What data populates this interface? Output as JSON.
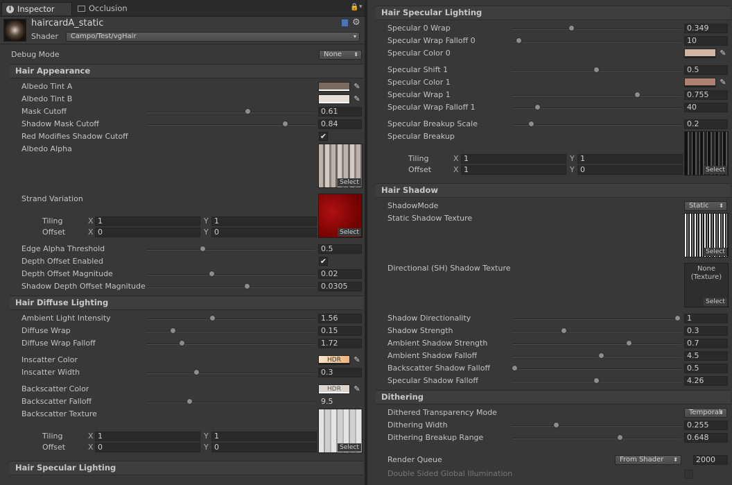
{
  "tabs": {
    "inspector": "Inspector",
    "occlusion": "Occlusion"
  },
  "material": {
    "name": "haircardA_static",
    "shader_label": "Shader",
    "shader_value": "Campo/Test/vgHair"
  },
  "debug": {
    "label": "Debug Mode",
    "value": "None"
  },
  "texture_select_label": "Select",
  "tiling_label": "Tiling",
  "offset_label": "Offset",
  "x_label": "X",
  "y_label": "Y",
  "hdr_label": "HDR",
  "hair_appearance": {
    "title": "Hair Appearance",
    "albedo_tint_a": {
      "label": "Albedo Tint A",
      "color": "#7b6a5e"
    },
    "albedo_tint_b": {
      "label": "Albedo Tint B",
      "color": "#e7dfd6"
    },
    "mask_cutoff": {
      "label": "Mask Cutoff",
      "value": "0.61",
      "fraction": 0.61
    },
    "shadow_mask_cutoff": {
      "label": "Shadow Mask Cutoff",
      "value": "0.84",
      "fraction": 0.84
    },
    "red_modifies": {
      "label": "Red Modifies Shadow Cutoff",
      "checked": true
    },
    "albedo_alpha": {
      "label": "Albedo Alpha"
    },
    "strand_variation": {
      "label": "Strand Variation",
      "tiling_x": "1",
      "tiling_y": "1",
      "offset_x": "0",
      "offset_y": "0"
    },
    "edge_alpha": {
      "label": "Edge Alpha Threshold",
      "value": "0.5",
      "fraction": 0.33
    },
    "depth_offset_enabled": {
      "label": "Depth Offset Enabled",
      "checked": true
    },
    "depth_offset_mag": {
      "label": "Depth Offset Magnitude",
      "value": "0.02",
      "fraction": 0.39
    },
    "shadow_depth_offset": {
      "label": "Shadow Depth Offset Magnitude",
      "value": "0.0305",
      "fraction": 0.59
    }
  },
  "hair_diffuse": {
    "title": "Hair Diffuse Lighting",
    "ambient": {
      "label": "Ambient Light Intensity",
      "value": "1.56",
      "fraction": 0.39
    },
    "diffuse_wrap": {
      "label": "Diffuse Wrap",
      "value": "0.15",
      "fraction": 0.16
    },
    "diffuse_wrap_falloff": {
      "label": "Diffuse Wrap Falloff",
      "value": "1.72",
      "fraction": 0.21
    },
    "inscatter_color": {
      "label": "Inscatter Color",
      "color": "#f4c99a"
    },
    "inscatter_width": {
      "label": "Inscatter Width",
      "value": "0.3",
      "fraction": 0.3
    },
    "backscatter_color": {
      "label": "Backscatter Color",
      "color": "#d8cfc8"
    },
    "backscatter_falloff": {
      "label": "Backscatter Falloff",
      "value": "9.5",
      "fraction": 0.26
    },
    "backscatter_texture": {
      "label": "Backscatter Texture",
      "tiling_x": "1",
      "tiling_y": "1",
      "offset_x": "0",
      "offset_y": "0"
    }
  },
  "hair_specular_left": {
    "title": "Hair Specular Lighting"
  },
  "hair_specular": {
    "title": "Hair Specular Lighting",
    "spec0_wrap": {
      "label": "Specular 0 Wrap",
      "value": "0.349",
      "fraction": 0.35
    },
    "spec_wrap_falloff0": {
      "label": "Specular Wrap Falloff 0",
      "value": "10",
      "fraction": 0.04
    },
    "spec_color0": {
      "label": "Specular Color 0",
      "color": "#d0b4a4"
    },
    "spec_shift1": {
      "label": "Specular Shift 1",
      "value": "0.5",
      "fraction": 0.5
    },
    "spec_color1": {
      "label": "Specular Color 1",
      "color": "#b08070"
    },
    "spec_wrap1": {
      "label": "Specular Wrap 1",
      "value": "0.755",
      "fraction": 0.755
    },
    "spec_wrap_falloff1": {
      "label": "Specular Wrap Falloff 1",
      "value": "40",
      "fraction": 0.15
    },
    "breakup_scale": {
      "label": "Specular Breakup Scale",
      "value": "0.2",
      "fraction": 0.12
    },
    "breakup": {
      "label": "Specular Breakup",
      "tiling_x": "1",
      "tiling_y": "1",
      "offset_x": "1",
      "offset_y": "0"
    }
  },
  "hair_shadow": {
    "title": "Hair Shadow",
    "mode": {
      "label": "ShadowMode",
      "value": "Static"
    },
    "static_tex": {
      "label": "Static Shadow Texture"
    },
    "dir_tex": {
      "label": "Directional (SH) Shadow Texture",
      "none_text_1": "None",
      "none_text_2": "(Texture)"
    },
    "directionality": {
      "label": "Shadow Directionality",
      "value": "1",
      "fraction": 1.0
    },
    "strength": {
      "label": "Shadow Strength",
      "value": "0.3",
      "fraction": 0.3
    },
    "ambient_strength": {
      "label": "Ambient Shadow Strength",
      "value": "0.7",
      "fraction": 0.7
    },
    "ambient_falloff": {
      "label": "Ambient Shadow Falloff",
      "value": "4.5",
      "fraction": 0.53
    },
    "backscatter_falloff": {
      "label": "Backscatter Shadow Falloff",
      "value": "0.5",
      "fraction": 0.0
    },
    "specular_falloff": {
      "label": "Specular Shadow Falloff",
      "value": "4.26",
      "fraction": 0.5
    }
  },
  "dithering": {
    "title": "Dithering",
    "mode": {
      "label": "Dithered Transparency Mode",
      "value": "Temporal"
    },
    "width": {
      "label": "Dithering Width",
      "value": "0.255",
      "fraction": 0.255
    },
    "breakup": {
      "label": "Dithering Breakup Range",
      "value": "0.648",
      "fraction": 0.648
    }
  },
  "render_queue": {
    "label": "Render Queue",
    "dropdown": "From Shader",
    "value": "2000"
  },
  "double_sided_gi": {
    "label": "Double Sided Global Illumination",
    "checked": false
  }
}
